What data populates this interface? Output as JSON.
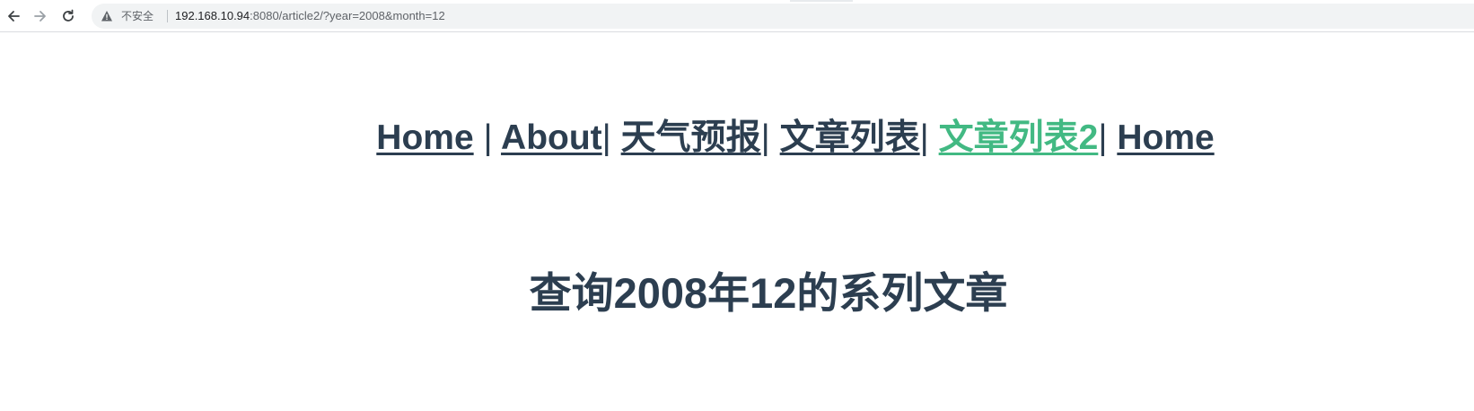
{
  "browser": {
    "security_label": "不安全",
    "url_host": "192.168.10.94",
    "url_rest": ":8080/article2/?year=2008&month=12",
    "icons": {
      "back": "back-arrow-icon",
      "forward": "forward-arrow-icon",
      "reload": "reload-icon",
      "security": "warning-triangle-icon"
    }
  },
  "nav": {
    "items": [
      {
        "label": "Home",
        "active": false
      },
      {
        "label": "About",
        "active": false
      },
      {
        "label": "天气预报",
        "active": false
      },
      {
        "label": "文章列表",
        "active": false
      },
      {
        "label": "文章列表2",
        "active": true
      },
      {
        "label": "Home",
        "active": false
      }
    ],
    "separator": "|"
  },
  "main": {
    "title": "查询2008年12的系列文章"
  },
  "colors": {
    "text": "#2c3e50",
    "active_link": "#42b983"
  }
}
